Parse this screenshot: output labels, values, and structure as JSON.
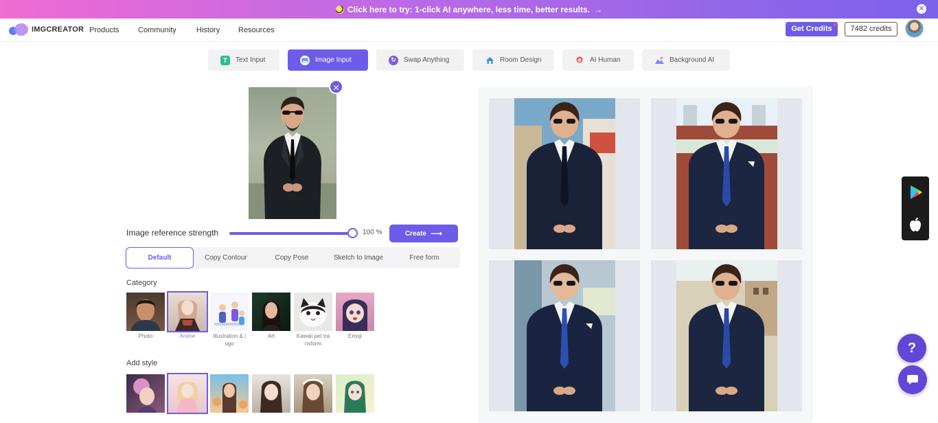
{
  "banner": {
    "text": "Click here to try: 1-click AI anywhere, less time, better results.",
    "arrow": "→",
    "close": "✕"
  },
  "nav": {
    "logo": "IMGCREATOR",
    "links": [
      "Products",
      "Community",
      "History",
      "Resources"
    ],
    "get_credits": "Get Credits",
    "credits": "7482 credits"
  },
  "tabs": [
    {
      "label": "Text Input",
      "icon": "text-input-icon",
      "color": "#2fbf8f"
    },
    {
      "label": "Image Input",
      "icon": "image-input-icon",
      "color": "#5a9cff",
      "active": true
    },
    {
      "label": "Swap Anything",
      "icon": "swap-icon",
      "color": "#7a5ce0"
    },
    {
      "label": "Room Design",
      "icon": "house-icon",
      "color": "#3a8ee8"
    },
    {
      "label": "AI Human",
      "icon": "ai-human-icon",
      "color": "#e05a4a"
    },
    {
      "label": "Background AI",
      "icon": "background-icon",
      "color": "#7a8cf0"
    }
  ],
  "editor": {
    "strength_label": "Image reference strength",
    "strength_value": 100,
    "strength_text": "100 %",
    "create_label": "Create",
    "remove": "✕",
    "modes": [
      "Default",
      "Copy Contour",
      "Copy Pose",
      "Sketch to Image",
      "Free form"
    ]
  },
  "category": {
    "title": "Category",
    "items": [
      {
        "label": "Photo"
      },
      {
        "label": "Anime",
        "selected": true
      },
      {
        "label": "Illustration & l ogo"
      },
      {
        "label": "Art"
      },
      {
        "label": "Kawaii pet tra nsform"
      },
      {
        "label": "Emoji"
      }
    ]
  },
  "style": {
    "title": "Add style"
  },
  "colors": {
    "accent": "#6d5ce8",
    "fab": "#6146d8"
  },
  "help": {
    "question": "?"
  }
}
